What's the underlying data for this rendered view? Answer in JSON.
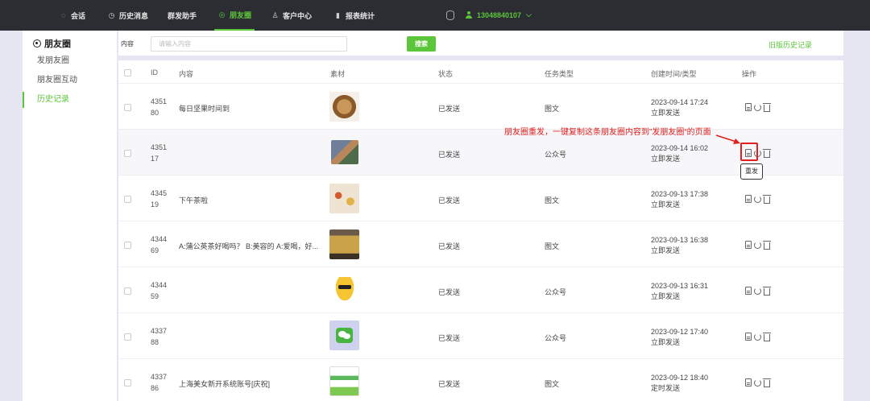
{
  "nav": {
    "items": [
      {
        "label": "会话",
        "icon": "chat-icon"
      },
      {
        "label": "历史消息",
        "icon": "clock-icon"
      },
      {
        "label": "群发助手",
        "icon": ""
      },
      {
        "label": "朋友圈",
        "icon": "moments-icon",
        "active": true
      },
      {
        "label": "客户中心",
        "icon": "person-icon"
      },
      {
        "label": "报表统计",
        "icon": "bar-chart-icon"
      }
    ],
    "user_phone": "13048840107",
    "accent_color": "#5cc63a",
    "bg_color": "#2b2d33"
  },
  "sidebar": {
    "title": "朋友圈",
    "items": [
      {
        "label": "发朋友圈"
      },
      {
        "label": "朋友圈互动"
      },
      {
        "label": "历史记录",
        "active": true
      }
    ]
  },
  "search": {
    "label": "内容",
    "placeholder": "请输入内容",
    "button": "搜索",
    "old_link": "旧版历史记录"
  },
  "table": {
    "headers": [
      "ID",
      "内容",
      "素材",
      "状态",
      "任务类型",
      "创建时间/类型",
      "操作"
    ],
    "rows": [
      {
        "id_a": "4351",
        "id_b": "80",
        "content": "每日坚果时间到",
        "status": "已发送",
        "type": "图文",
        "date": "2023-09-14 17:24",
        "mode": "立即发送",
        "thumb": "nuts"
      },
      {
        "id_a": "4351",
        "id_b": "17",
        "content": "",
        "status": "已发送",
        "type": "公众号",
        "date": "2023-09-14 16:02",
        "mode": "立即发送",
        "thumb": "photo"
      },
      {
        "id_a": "4345",
        "id_b": "19",
        "content": "下午茶啦",
        "status": "已发送",
        "type": "图文",
        "date": "2023-09-13 17:38",
        "mode": "立即发送",
        "thumb": "tea"
      },
      {
        "id_a": "4344",
        "id_b": "69",
        "content": "A:蒲公英茶好喝吗？ B:美容的 A:爱喝，好...",
        "status": "已发送",
        "type": "图文",
        "date": "2023-09-13 16:38",
        "mode": "立即发送",
        "thumb": "jar"
      },
      {
        "id_a": "4344",
        "id_b": "59",
        "content": "",
        "status": "已发送",
        "type": "公众号",
        "date": "2023-09-13 16:31",
        "mode": "立即发送",
        "thumb": "emoji"
      },
      {
        "id_a": "4337",
        "id_b": "88",
        "content": "",
        "status": "已发送",
        "type": "公众号",
        "date": "2023-09-12 17:40",
        "mode": "立即发送",
        "thumb": "wechat"
      },
      {
        "id_a": "4337",
        "id_b": "86",
        "content": "上海美女新开系统账号[庆祝]",
        "status": "已发送",
        "type": "图文",
        "date": "2023-09-12 18:40",
        "mode": "定时发送",
        "thumb": "card"
      }
    ]
  },
  "annotation": {
    "text": "朋友圈重发，一键复制这条朋友圈内容到”发朋友圈“的页面",
    "tooltip": "重发",
    "color": "#e02020"
  }
}
